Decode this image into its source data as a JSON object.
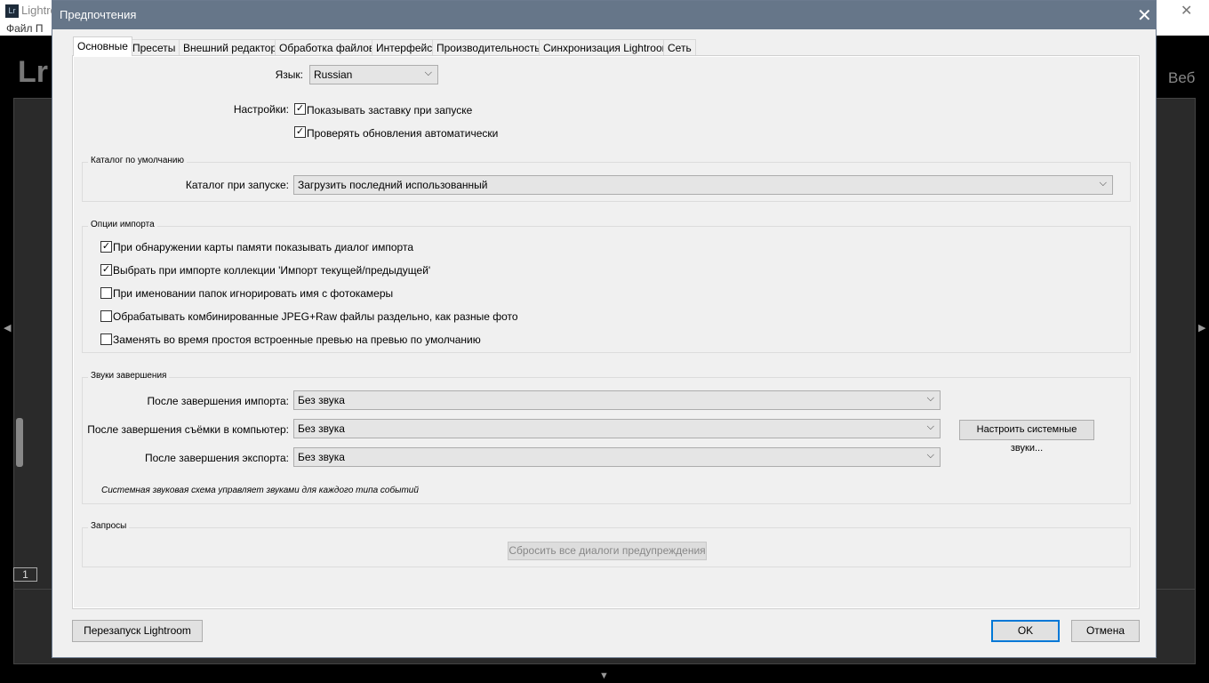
{
  "app": {
    "logo": "Lr",
    "title": "Lightroom",
    "menu": "Файл  П",
    "brand": "Lr",
    "module": "Веб",
    "filmstrip_page": "1"
  },
  "dialog": {
    "title": "Предпочтения",
    "tabs": [
      "Основные",
      "Пресеты",
      "Внешний редактор",
      "Обработка файлов",
      "Интерфейс",
      "Производительность",
      "Синхронизация Lightroom",
      "Сеть"
    ],
    "active_tab": 0,
    "language": {
      "label": "Язык:",
      "value": "Russian"
    },
    "settings": {
      "label": "Настройки:",
      "items": [
        {
          "label": "Показывать заставку при запуске",
          "checked": true
        },
        {
          "label": "Проверять обновления автоматически",
          "checked": true
        }
      ]
    },
    "catalog": {
      "group": "Каталог по умолчанию",
      "label": "Каталог при запуске:",
      "value": "Загрузить последний использованный"
    },
    "import": {
      "group": "Опции импорта",
      "items": [
        {
          "label": "При обнаружении карты памяти показывать диалог импорта",
          "checked": true
        },
        {
          "label": "Выбрать при импорте коллекции 'Импорт текущей/предыдущей'",
          "checked": true
        },
        {
          "label": "При именовании папок игнорировать имя с фотокамеры",
          "checked": false
        },
        {
          "label": "Обрабатывать комбинированные JPEG+Raw файлы раздельно, как разные фото",
          "checked": false
        },
        {
          "label": "Заменять во время простоя встроенные превью на превью по умолчанию",
          "checked": false
        }
      ]
    },
    "sounds": {
      "group": "Звуки завершения",
      "rows": [
        {
          "label": "После завершения импорта:",
          "value": "Без звука"
        },
        {
          "label": "После завершения съёмки в компьютер:",
          "value": "Без звука"
        },
        {
          "label": "После завершения экспорта:",
          "value": "Без звука"
        }
      ],
      "system_button": "Настроить системные звуки...",
      "note": "Системная звуковая схема управляет звуками для каждого типа событий"
    },
    "prompts": {
      "group": "Запросы",
      "reset_button": "Сбросить все диалоги предупреждения"
    },
    "restart_button": "Перезапуск Lightroom",
    "ok_button": "OK",
    "cancel_button": "Отмена"
  }
}
